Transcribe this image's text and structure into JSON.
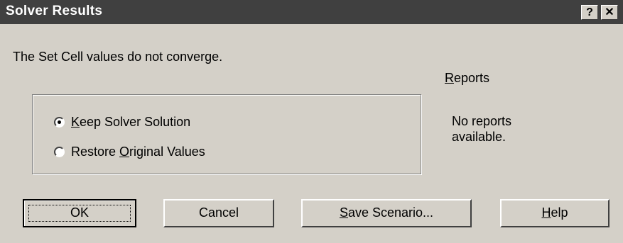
{
  "window": {
    "title": "Solver Results",
    "help_glyph": "?",
    "close_glyph": "✕"
  },
  "message": "The Set Cell values do not converge.",
  "reports": {
    "label_accel": "R",
    "label_rest": "eports",
    "info": "No reports available."
  },
  "options": [
    {
      "pre": "",
      "accel": "K",
      "post": "eep Solver Solution",
      "selected": true
    },
    {
      "pre": "Restore ",
      "accel": "O",
      "post": "riginal Values",
      "selected": false
    }
  ],
  "buttons": {
    "ok": "OK",
    "cancel": "Cancel",
    "save_accel": "S",
    "save_rest": "ave Scenario...",
    "help_accel": "H",
    "help_rest": "elp"
  },
  "colors": {
    "dialog_bg": "#d4d0c8",
    "titlebar_bg": "#404040"
  }
}
